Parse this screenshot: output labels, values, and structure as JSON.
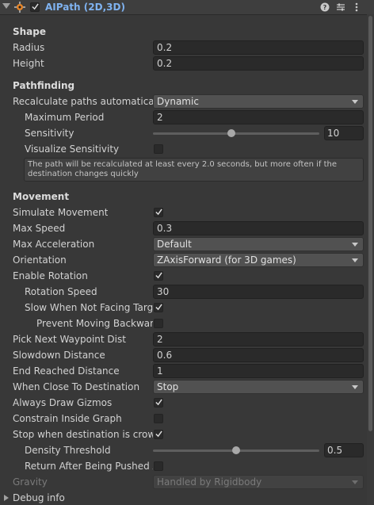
{
  "header": {
    "title": "AIPath (2D,3D)",
    "enabled": true,
    "icons": [
      "foldout-arrow-icon",
      "component-icon",
      "help-icon",
      "preset-icon",
      "more-icon"
    ]
  },
  "sections": {
    "shape": "Shape",
    "pathfinding": "Pathfinding",
    "movement": "Movement"
  },
  "shape": {
    "radius_label": "Radius",
    "radius_value": "0.2",
    "height_label": "Height",
    "height_value": "0.2"
  },
  "pathfinding": {
    "recalc_label": "Recalculate paths automatically",
    "recalc_value": "Dynamic",
    "max_period_label": "Maximum Period",
    "max_period_value": "2",
    "sensitivity_label": "Sensitivity",
    "sensitivity_value": "10",
    "sensitivity_fraction": 0.47,
    "visualize_label": "Visualize Sensitivity",
    "visualize_checked": false,
    "help_text": "The path will be recalculated at least every 2.0 seconds, but more often if the destination changes quickly"
  },
  "movement": {
    "simulate_label": "Simulate Movement",
    "simulate_checked": true,
    "max_speed_label": "Max Speed",
    "max_speed_value": "0.3",
    "max_accel_label": "Max Acceleration",
    "max_accel_value": "Default",
    "orientation_label": "Orientation",
    "orientation_value": "ZAxisForward (for 3D games)",
    "enable_rotation_label": "Enable Rotation",
    "enable_rotation_checked": true,
    "rotation_speed_label": "Rotation Speed",
    "rotation_speed_value": "30",
    "slow_not_facing_label": "Slow When Not Facing Target",
    "slow_not_facing_checked": true,
    "prevent_backwards_label": "Prevent Moving Backwards",
    "prevent_backwards_checked": false,
    "pick_next_label": "Pick Next Waypoint Dist",
    "pick_next_value": "2",
    "slowdown_label": "Slowdown Distance",
    "slowdown_value": "0.6",
    "end_reached_label": "End Reached Distance",
    "end_reached_value": "1",
    "when_close_label": "When Close To Destination",
    "when_close_value": "Stop",
    "always_gizmos_label": "Always Draw Gizmos",
    "always_gizmos_checked": true,
    "constrain_label": "Constrain Inside Graph",
    "constrain_checked": false,
    "stop_crowded_label": "Stop when destination is crowded",
    "stop_crowded_checked": true,
    "density_label": "Density Threshold",
    "density_value": "0.5",
    "density_fraction": 0.5,
    "return_pushed_label": "Return After Being Pushed Away",
    "return_pushed_checked": false,
    "gravity_label": "Gravity",
    "gravity_value": "Handled by Rigidbody"
  },
  "debug": {
    "label": "Debug info"
  }
}
